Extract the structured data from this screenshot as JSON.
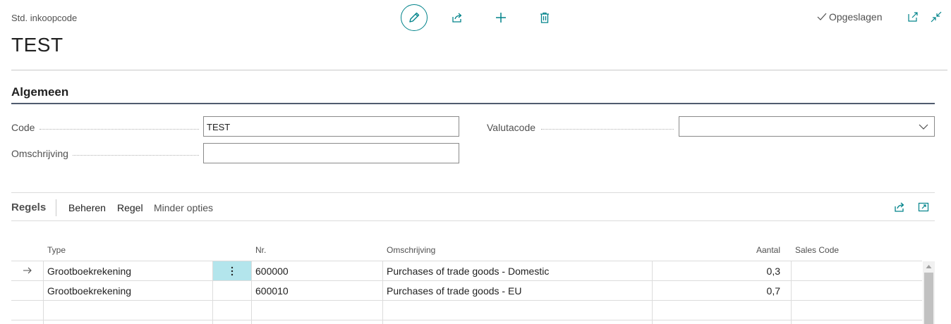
{
  "header": {
    "breadcrumb": "Std. inkoopcode",
    "title": "TEST",
    "actions": [
      {
        "name": "edit",
        "icon": "pencil-icon"
      },
      {
        "name": "share",
        "icon": "share-icon"
      },
      {
        "name": "new",
        "icon": "plus-icon"
      },
      {
        "name": "delete",
        "icon": "trash-icon"
      }
    ],
    "saved_status": "Opgeslagen",
    "accent_color": "#00838a"
  },
  "general": {
    "section_title": "Algemeen",
    "code_label": "Code",
    "code_value": "TEST",
    "description_label": "Omschrijving",
    "description_value": "",
    "currency_label": "Valutacode",
    "currency_value": ""
  },
  "lines": {
    "title": "Regels",
    "actions": [
      "Beheren",
      "Regel",
      "Minder opties"
    ],
    "columns": {
      "type": "Type",
      "no": "Nr.",
      "description": "Omschrijving",
      "quantity": "Aantal",
      "sales_code": "Sales Code"
    },
    "rows": [
      {
        "type": "Grootboekrekening",
        "no": "600000",
        "description": "Purchases of trade goods - Domestic",
        "quantity": "0,3",
        "sales_code": "",
        "current": true
      },
      {
        "type": "Grootboekrekening",
        "no": "600010",
        "description": "Purchases of trade goods - EU",
        "quantity": "0,7",
        "sales_code": "",
        "current": false
      }
    ]
  }
}
